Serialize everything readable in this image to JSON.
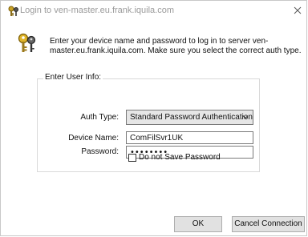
{
  "window": {
    "title": "Login to ven-master.eu.frank.iquila.com",
    "icon": "keys-icon",
    "close_icon": "close-icon"
  },
  "header": {
    "icon": "keys-icon",
    "message": "Enter your device name and password to log in to server ven-master.eu.frank.iquila.com. Make sure you select the correct auth type."
  },
  "form": {
    "group_title": "Enter User Info:",
    "auth_type_label": "Auth Type:",
    "auth_type_value": "Standard Password Authentication",
    "device_name_label": "Device Name:",
    "device_name_value": "ComFilSvr1UK",
    "password_label": "Password:",
    "password_value": "••••••••",
    "save_password_label": "Do not Save Password",
    "save_password_checked": false
  },
  "buttons": {
    "ok_label": "OK",
    "cancel_label": "Cancel Connection"
  }
}
